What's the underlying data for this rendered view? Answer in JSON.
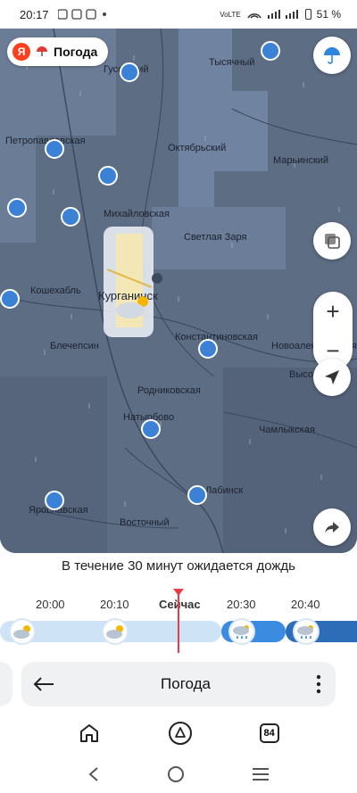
{
  "status": {
    "time": "20:17",
    "battery": "51 %",
    "network": "VoLTE"
  },
  "brand": {
    "ya": "Я",
    "name": "Погода"
  },
  "map": {
    "places": [
      "Тысячный",
      "Октябрьский",
      "Марьинский",
      "Петропавловская",
      "Михайловская",
      "Светлая Заря",
      "Кошехабль",
      "Курганинск",
      "Константиновская",
      "Новоалексеевская",
      "Блечепсин",
      "Родниковская",
      "Высокое",
      "Натырбово",
      "Чамлыкская",
      "Ярославская",
      "Лабинск",
      "Восточный",
      "Гусевский"
    ]
  },
  "forecast": {
    "message": "В течение 30 минут ожидается дождь"
  },
  "timeline": {
    "labels": [
      "20:00",
      "20:10",
      "Сейчас",
      "20:30",
      "20:40"
    ],
    "now_color": "#e73d4a"
  },
  "nav": {
    "title": "Погода"
  },
  "tabs": {
    "count": "84"
  }
}
